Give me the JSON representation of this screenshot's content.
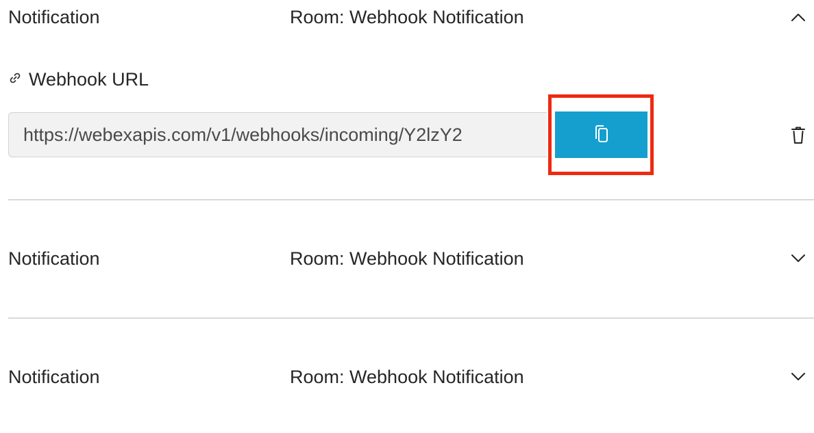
{
  "notifications": [
    {
      "title": "Notification",
      "room": "Room: Webhook Notification",
      "expanded": true,
      "toggle_icon": "chevron-up-icon",
      "details": {
        "link_icon": "link-icon",
        "label": "Webhook URL",
        "url_value": "https://webexapis.com/v1/webhooks/incoming/Y2lzY2",
        "copy_icon": "copy-icon",
        "delete_icon": "trash-icon"
      }
    },
    {
      "title": "Notification",
      "room": "Room: Webhook Notification",
      "expanded": false,
      "toggle_icon": "chevron-down-icon"
    },
    {
      "title": "Notification",
      "room": "Room: Webhook Notification",
      "expanded": false,
      "toggle_icon": "chevron-down-icon"
    }
  ],
  "colors": {
    "copy_button": "#159fcf",
    "highlight_border": "#ee2a12",
    "field_background": "#f2f2f2",
    "divider": "#d9d9d9"
  }
}
